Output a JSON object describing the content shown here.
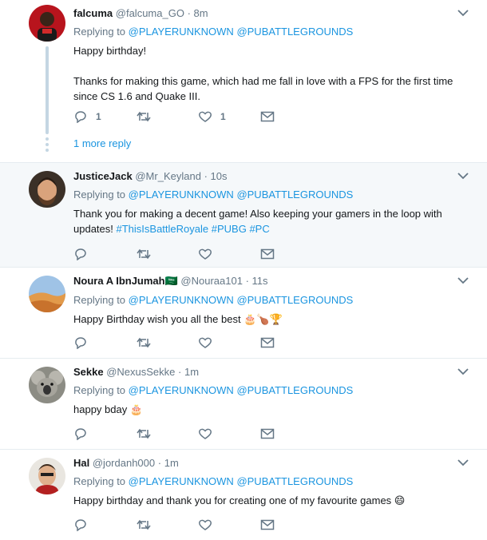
{
  "colors": {
    "link": "#1b95e0",
    "meta": "#657786",
    "text": "#14171a",
    "divider": "#e6ecf0",
    "highlight_bg": "#f5f8fa"
  },
  "replying_to_label": "Replying to",
  "replying_handles": [
    "@PLAYERUNKNOWN",
    "@PUBATTLEGROUNDS"
  ],
  "tweets": [
    {
      "name": "falcuma",
      "handle": "@falcuma_GO",
      "dot": "·",
      "time": "8m",
      "text_line1": "Happy birthday!",
      "text_line2": "Thanks for making this game, which had me fall in love with a FPS for the first time since CS 1.6 and Quake III.",
      "reply_count": "1",
      "like_count": "1",
      "more_reply": "1 more reply"
    },
    {
      "name": "JusticeJack",
      "handle": "@Mr_Keyland",
      "dot": "·",
      "time": "10s",
      "text": "Thank you for making a decent game! Also keeping your gamers in the loop with updates!",
      "hashtags": [
        "#ThisIsBattleRoyale",
        "#PUBG",
        "#PC"
      ]
    },
    {
      "name": "Noura A IbnJumah",
      "flag": "🇸🇦",
      "handle": "@Nouraa101",
      "dot": "·",
      "time": "11s",
      "text": "Happy Birthday wish you all the best",
      "emoji": "🎂🍗🏆"
    },
    {
      "name": "Sekke",
      "handle": "@NexusSekke",
      "dot": "·",
      "time": "1m",
      "text": "happy bday",
      "emoji": "🎂"
    },
    {
      "name": "Hal",
      "handle": "@jordanh000",
      "dot": "·",
      "time": "1m",
      "text": "Happy birthday and thank you for creating one of my favourite games",
      "emoji": "😄"
    }
  ]
}
